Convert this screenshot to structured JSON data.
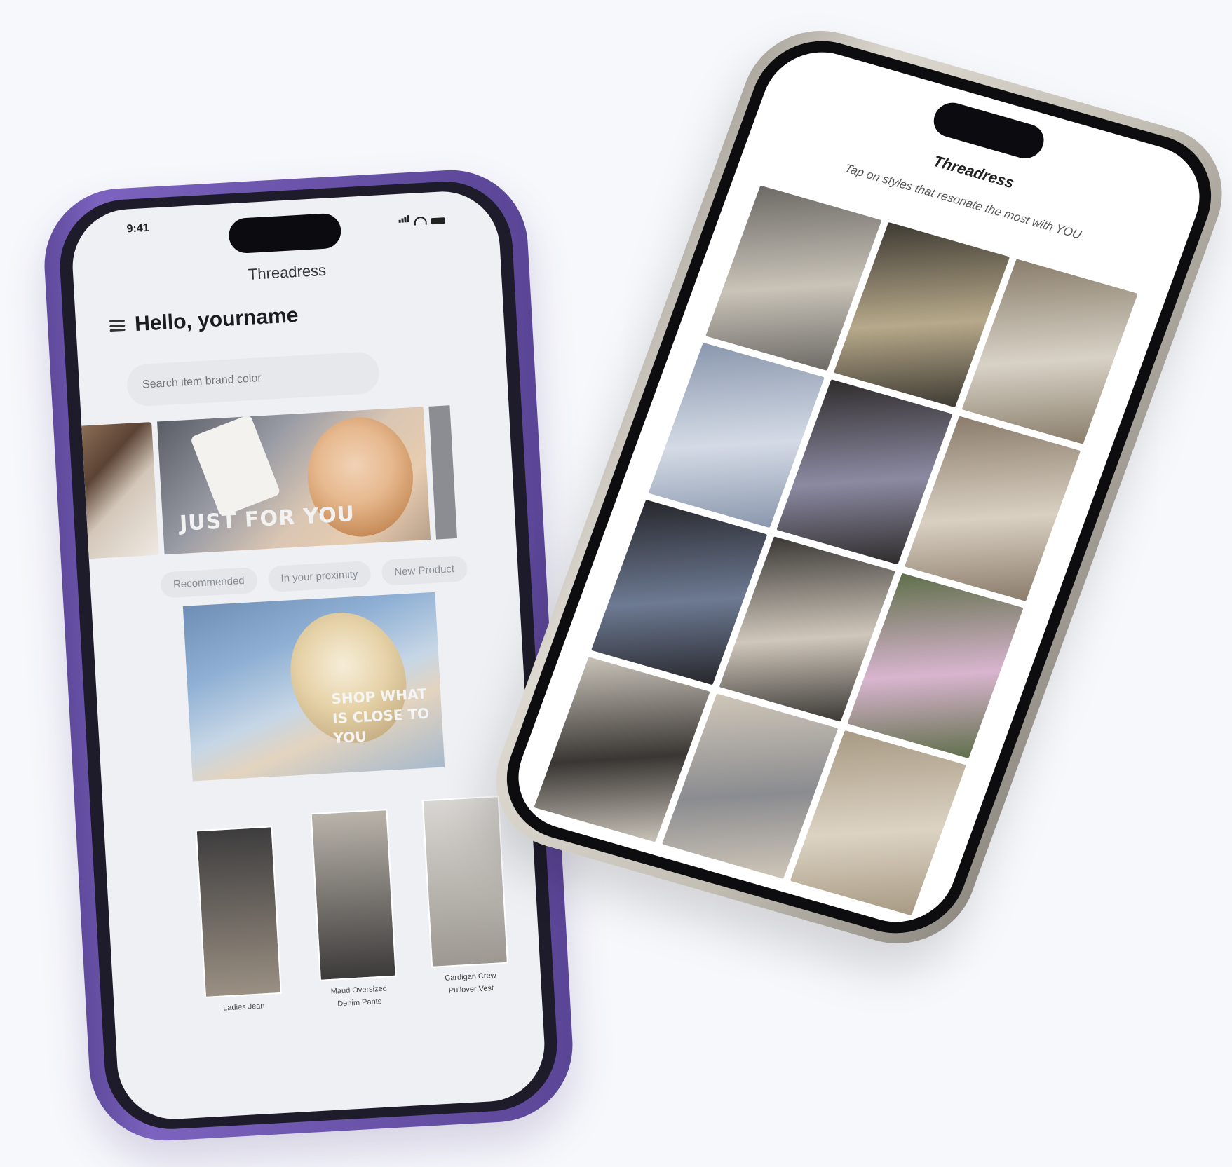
{
  "left_phone": {
    "status_time": "9:41",
    "brand": "Threadress",
    "greeting": "Hello, yourname",
    "search_placeholder": "Search item brand color",
    "banner_text": "JUST FOR YOU",
    "chips": [
      "Recommended",
      "In your proximity",
      "New Product"
    ],
    "feature_text": "SHOP WHAT IS CLOSE TO YOU",
    "products": [
      {
        "label": "Ladies Jean",
        "color_a": "#3e3d3e",
        "color_b": "#9a8f82"
      },
      {
        "label": "Maud Oversized Denim Pants",
        "color_a": "#b9b3aa",
        "color_b": "#3c3a3a"
      },
      {
        "label": "Cardigan Crew Pullover Vest",
        "color_a": "#d8d6d2",
        "color_b": "#9d9891"
      }
    ]
  },
  "right_phone": {
    "brand": "Threadress",
    "prompt": "Tap on styles that resonate the most with YOU",
    "tiles": [
      {
        "name": "style-tile-1",
        "c1": "#6d6a66",
        "c2": "#c9c3b8"
      },
      {
        "name": "style-tile-2",
        "c1": "#3e3a33",
        "c2": "#b7a98a"
      },
      {
        "name": "style-tile-3",
        "c1": "#8a7e6c",
        "c2": "#d8d2c6"
      },
      {
        "name": "style-tile-4",
        "c1": "#8a97ad",
        "c2": "#d4dbe6"
      },
      {
        "name": "style-tile-5",
        "c1": "#2f2c2c",
        "c2": "#8c8aa2"
      },
      {
        "name": "style-tile-6",
        "c1": "#8b7c6b",
        "c2": "#d9d0c2"
      },
      {
        "name": "style-tile-7",
        "c1": "#27272c",
        "c2": "#6d7a93"
      },
      {
        "name": "style-tile-8",
        "c1": "#3b3835",
        "c2": "#cfc7bb"
      },
      {
        "name": "style-tile-9",
        "c1": "#5f6f4b",
        "c2": "#d9b5cf"
      },
      {
        "name": "style-tile-10",
        "c1": "#c9c3b9",
        "c2": "#3a3633"
      },
      {
        "name": "style-tile-11",
        "c1": "#cfc6b8",
        "c2": "#8b8c90"
      },
      {
        "name": "style-tile-12",
        "c1": "#a89a84",
        "c2": "#dcd3c3"
      }
    ]
  }
}
